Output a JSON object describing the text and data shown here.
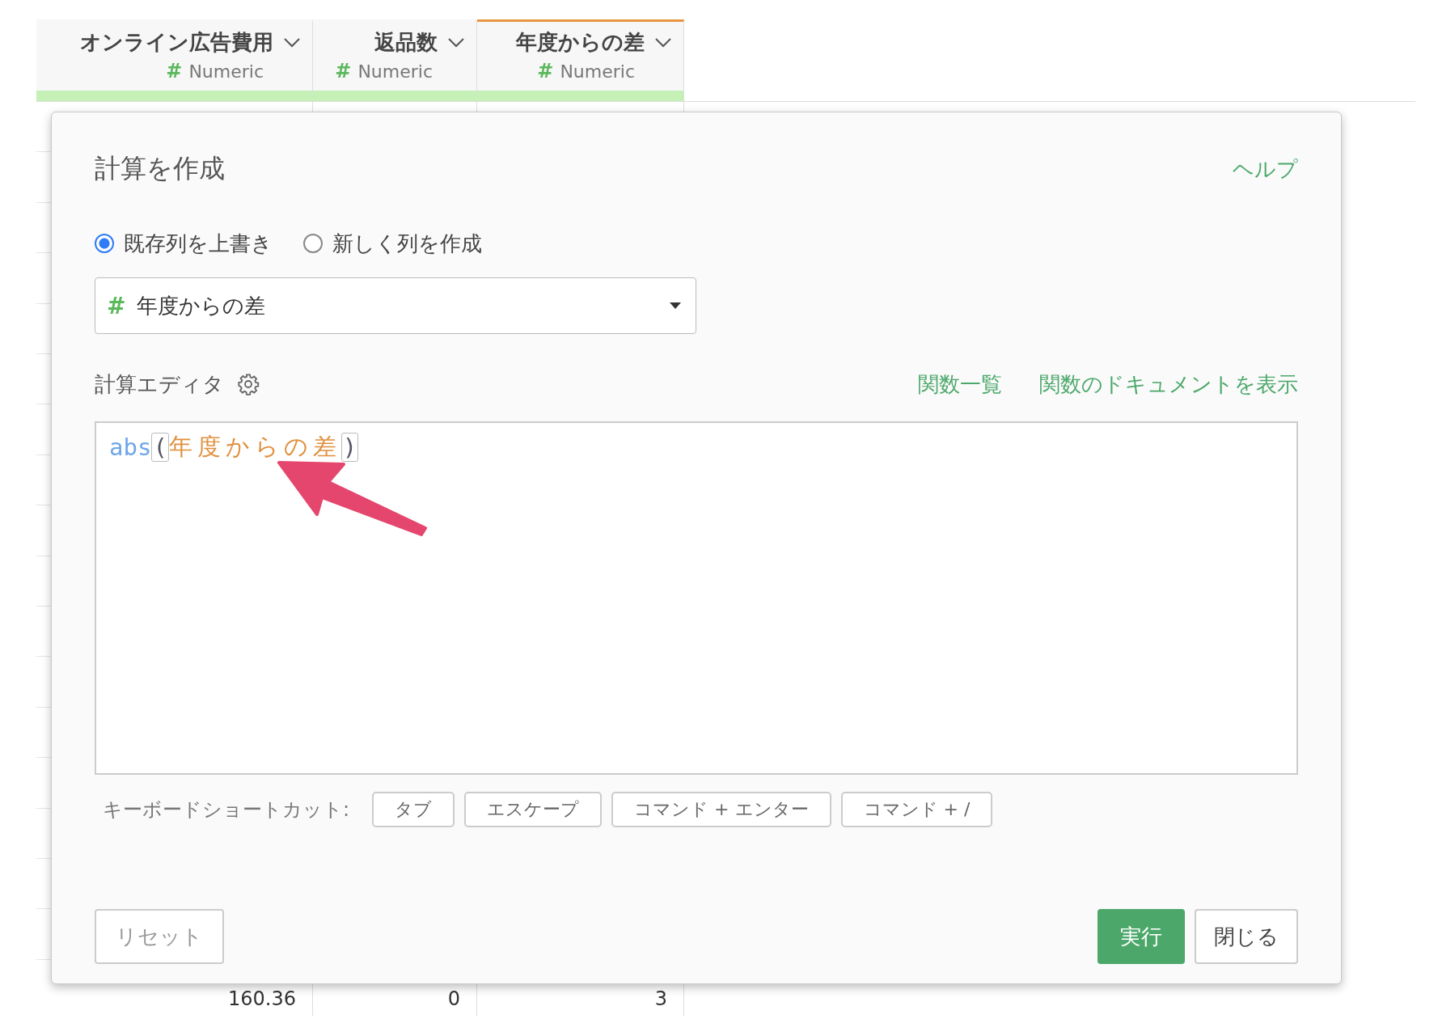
{
  "table": {
    "columns": [
      {
        "name": "オンライン広告費用",
        "type_icon": "#",
        "type": "Numeric",
        "selected": false
      },
      {
        "name": "返品数",
        "type_icon": "#",
        "type": "Numeric",
        "selected": false
      },
      {
        "name": "年度からの差",
        "type_icon": "#",
        "type": "Numeric",
        "selected": true
      }
    ],
    "rows": [
      [
        "160.36",
        "0",
        "3"
      ]
    ]
  },
  "dialog": {
    "title": "計算を作成",
    "help_link": "ヘルプ",
    "modes": [
      {
        "label": "既存列を上書き",
        "selected": true
      },
      {
        "label": "新しく列を作成",
        "selected": false
      }
    ],
    "column_select": {
      "type_icon": "#",
      "value": "年度からの差"
    },
    "editor_label": "計算エディタ",
    "editor_links": [
      "関数一覧",
      "関数のドキュメントを表示"
    ],
    "editor_tokens": [
      {
        "kind": "function",
        "text": "abs"
      },
      {
        "kind": "paren",
        "text": "("
      },
      {
        "kind": "column",
        "text": "年度からの差"
      },
      {
        "kind": "paren",
        "text": ")"
      }
    ],
    "shortcuts_label": "キーボードショートカット:",
    "shortcuts": [
      "タブ",
      "エスケープ",
      "コマンド + エンター",
      "コマンド + /"
    ],
    "reset_button": "リセット",
    "run_button": "実行",
    "close_button": "閉じる"
  }
}
